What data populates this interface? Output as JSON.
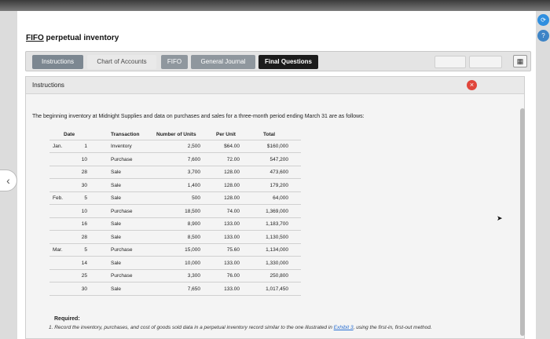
{
  "title": {
    "fifo": "FIFO",
    "rest": " perpetual inventory"
  },
  "tabs": [
    {
      "label": "Instructions"
    },
    {
      "label": "Chart of Accounts"
    },
    {
      "label": "FIFO"
    },
    {
      "label": "General Journal"
    },
    {
      "label": "Final Questions"
    }
  ],
  "panel": {
    "header": "Instructions",
    "intro": "The beginning inventory at Midnight Supplies and data on purchases and sales for a three-month period ending March 31 are as follows:"
  },
  "table": {
    "headers": [
      "Date",
      "Transaction",
      "Number of Units",
      "Per Unit",
      "Total"
    ],
    "rows": [
      {
        "month": "Jan.",
        "day": "1",
        "transaction": "Inventory",
        "units": "2,500",
        "per_unit": "$64.00",
        "total": "$160,000"
      },
      {
        "month": "",
        "day": "10",
        "transaction": "Purchase",
        "units": "7,600",
        "per_unit": "72.00",
        "total": "547,200"
      },
      {
        "month": "",
        "day": "28",
        "transaction": "Sale",
        "units": "3,700",
        "per_unit": "128.00",
        "total": "473,600"
      },
      {
        "month": "",
        "day": "30",
        "transaction": "Sale",
        "units": "1,400",
        "per_unit": "128.00",
        "total": "179,200"
      },
      {
        "month": "Feb.",
        "day": "5",
        "transaction": "Sale",
        "units": "500",
        "per_unit": "128.00",
        "total": "64,000"
      },
      {
        "month": "",
        "day": "10",
        "transaction": "Purchase",
        "units": "18,500",
        "per_unit": "74.00",
        "total": "1,369,000"
      },
      {
        "month": "",
        "day": "16",
        "transaction": "Sale",
        "units": "8,900",
        "per_unit": "133.00",
        "total": "1,183,700"
      },
      {
        "month": "",
        "day": "28",
        "transaction": "Sale",
        "units": "8,500",
        "per_unit": "133.00",
        "total": "1,130,500"
      },
      {
        "month": "Mar.",
        "day": "5",
        "transaction": "Purchase",
        "units": "15,000",
        "per_unit": "75.60",
        "total": "1,134,000"
      },
      {
        "month": "",
        "day": "14",
        "transaction": "Sale",
        "units": "10,000",
        "per_unit": "133.00",
        "total": "1,330,000"
      },
      {
        "month": "",
        "day": "25",
        "transaction": "Purchase",
        "units": "3,300",
        "per_unit": "76.00",
        "total": "250,800"
      },
      {
        "month": "",
        "day": "30",
        "transaction": "Sale",
        "units": "7,650",
        "per_unit": "133.00",
        "total": "1,017,450"
      }
    ]
  },
  "required": {
    "label": "Required:",
    "item_number": "1.",
    "item_text_before": "Record the inventory, purchases, and cost of goods sold data in a perpetual inventory record similar to the one illustrated in ",
    "item_link": "Exhibit 3",
    "item_text_after": ", using the first-in, first-out method."
  },
  "icons": {
    "close": "×",
    "grid": "▦",
    "left_nav": "‹",
    "right_1": "⟳",
    "right_2": "?"
  }
}
